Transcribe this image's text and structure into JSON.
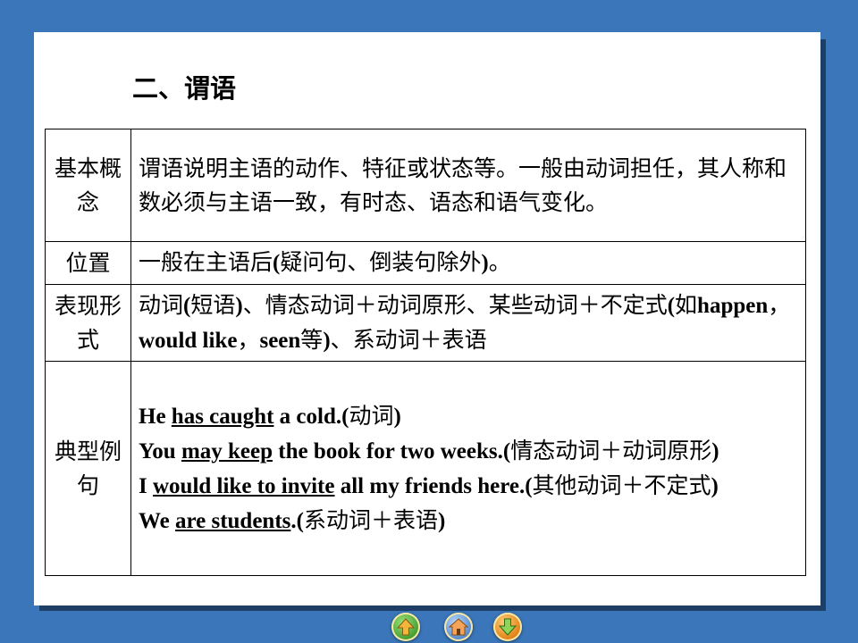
{
  "slide": {
    "title": "二、谓语"
  },
  "rows": [
    {
      "head": "基本概念",
      "text": "谓语说明主语的动作、特征或状态等。一般由动词担任，其人称和数必须与主语一致，有时态、语态和语气变化。"
    },
    {
      "head": "位置",
      "text_a": "一般在主语后",
      "paren_open": "(",
      "text_b": "疑问句、倒装句除外",
      "paren_close": ")",
      "text_c": "。"
    },
    {
      "head": "表现形式",
      "p1": "动词",
      "p2": "(",
      "p3": "短语",
      "p4": ")",
      "p5": "、情态动词＋动词原形、某些动词＋不定式",
      "p6": "(",
      "p7": "如",
      "p8": "happen",
      "p9": "，",
      "p10": "would like",
      "p11": "，",
      "p12": "seen",
      "p13": "等",
      "p14": ")",
      "p15": "、系动词＋表语"
    },
    {
      "head": "典型例句",
      "examples": [
        {
          "pre": "He ",
          "u": "has caught",
          "post": " a cold.(",
          "cn": "动词",
          "end": ")"
        },
        {
          "pre": "You ",
          "u": "may keep",
          "post": " the book for two weeks.(",
          "cn": "情态动词＋动词原形",
          "end": ")"
        },
        {
          "pre": "I ",
          "u": "would like to invite",
          "post": " all my friends here.(",
          "cn": "其他动词＋不定式",
          "end": ")"
        },
        {
          "pre": "We ",
          "u": "are students",
          "post": ".(",
          "cn": "系动词＋表语",
          "end": ")"
        }
      ]
    }
  ],
  "nav": {
    "prev_icon": "arrow-up-icon",
    "home_icon": "home-icon",
    "next_icon": "arrow-down-icon"
  }
}
